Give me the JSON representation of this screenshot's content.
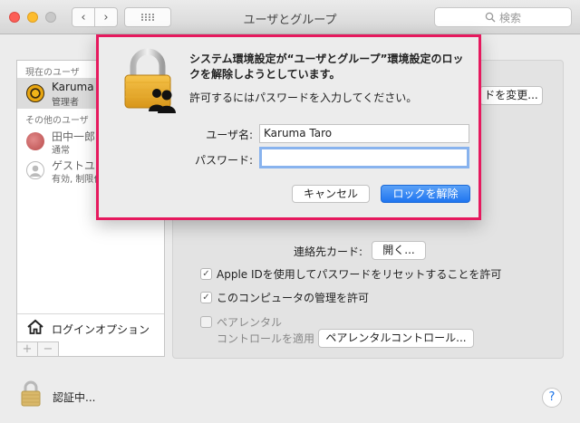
{
  "window": {
    "title": "ユーザとグループ",
    "search_placeholder": "検索"
  },
  "sidebar": {
    "current_users_label": "現在のユーザ",
    "other_users_label": "その他のユーザ",
    "users": [
      {
        "name": "Karuma T",
        "role": "管理者"
      },
      {
        "name": "田中一郎",
        "role": "通常"
      },
      {
        "name": "ゲストユ",
        "role": "有効, 制限付"
      }
    ],
    "login_options_label": "ログインオプション",
    "add_label": "+",
    "remove_label": "−"
  },
  "panel": {
    "change_password_button": "ドを変更...",
    "contact_card_label": "連絡先カード:",
    "contact_card_button": "開く...",
    "options": [
      {
        "label": "Apple IDを使用してパスワードをリセットすることを許可",
        "checked": true
      },
      {
        "label": "このコンピュータの管理を許可",
        "checked": true
      }
    ],
    "parental_label_line1": "ペアレンタル",
    "parental_label_line2": "コントロールを適用",
    "parental_button": "ペアレンタルコントロール..."
  },
  "footer": {
    "auth_text": "認証中...",
    "help_label": "?"
  },
  "dialog": {
    "title": "システム環境設定が“ユーザとグループ”環境設定のロックを解除しようとしています。",
    "subtitle": "許可するにはパスワードを入力してください。",
    "username_label": "ユーザ名:",
    "username_value": "Karuma Taro",
    "password_label": "パスワード:",
    "password_value": "",
    "cancel_button": "キャンセル",
    "unlock_button": "ロックを解除",
    "highlight_color": "#e6195e"
  }
}
